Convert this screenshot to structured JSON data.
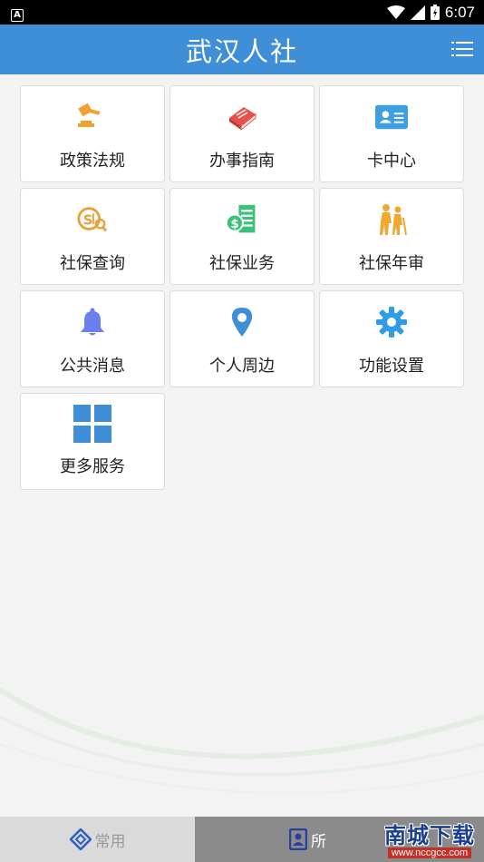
{
  "status_bar": {
    "time": "6:07",
    "notification_icon": "A"
  },
  "header": {
    "title": "武汉人社",
    "menu_icon": "list-menu-icon"
  },
  "tiles": [
    {
      "label": "政策法规",
      "icon": "gavel-icon",
      "color": "#f0a030"
    },
    {
      "label": "办事指南",
      "icon": "book-icon",
      "color": "#e8504a"
    },
    {
      "label": "卡中心",
      "icon": "id-card-icon",
      "color": "#3fa0e0"
    },
    {
      "label": "社保查询",
      "icon": "si-search-icon",
      "color": "#e8a23a"
    },
    {
      "label": "社保业务",
      "icon": "si-business-icon",
      "color": "#3cc07a"
    },
    {
      "label": "社保年审",
      "icon": "elderly-icon",
      "color": "#f0a830"
    },
    {
      "label": "公共消息",
      "icon": "bell-icon",
      "color": "#6a7ff0"
    },
    {
      "label": "个人周边",
      "icon": "location-pin-icon",
      "color": "#3f8fd8"
    },
    {
      "label": "功能设置",
      "icon": "gear-icon",
      "color": "#2f9ce8"
    },
    {
      "label": "更多服务",
      "icon": "grid-icon",
      "color": "#3f8fd8"
    }
  ],
  "bottom_nav": {
    "tabs": [
      {
        "label": "常用",
        "icon": "diamond-icon",
        "active": false
      },
      {
        "label": "所",
        "icon": "contact-book-icon",
        "active": true
      }
    ]
  },
  "watermark": {
    "title": "南城下载",
    "url": "www.nccgcc.com"
  }
}
